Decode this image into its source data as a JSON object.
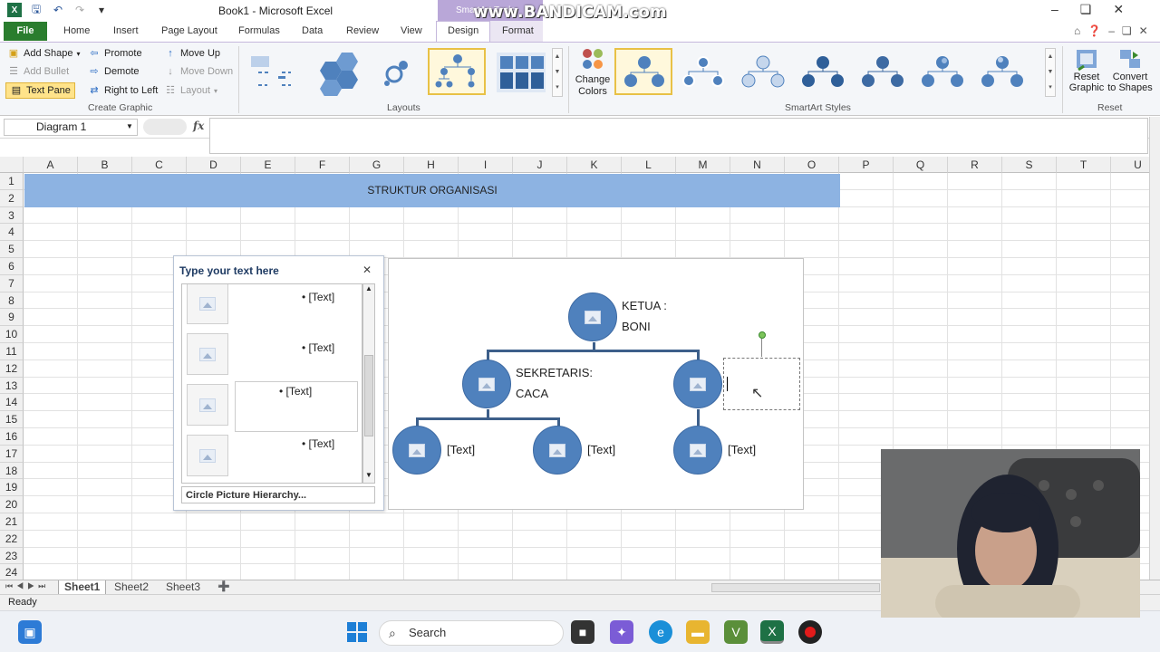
{
  "window": {
    "title": "Book1 - Microsoft Excel",
    "context_tab_title": "SmartArt Tools",
    "watermark": "www.BANDICAM.com"
  },
  "tabs": [
    "File",
    "Home",
    "Insert",
    "Page Layout",
    "Formulas",
    "Data",
    "Review",
    "View",
    "Design",
    "Format"
  ],
  "ribbon": {
    "create_graphic": {
      "label": "Create Graphic",
      "add_shape": "Add Shape",
      "add_bullet": "Add Bullet",
      "text_pane": "Text Pane",
      "promote": "Promote",
      "demote": "Demote",
      "right_to_left": "Right to Left",
      "move_up": "Move Up",
      "move_down": "Move Down",
      "layout": "Layout"
    },
    "layouts": {
      "label": "Layouts"
    },
    "change_colors": {
      "line1": "Change",
      "line2": "Colors"
    },
    "styles": {
      "label": "SmartArt Styles"
    },
    "reset": {
      "label": "Reset",
      "reset_graphic_1": "Reset",
      "reset_graphic_2": "Graphic",
      "convert_1": "Convert",
      "convert_2": "to Shapes"
    }
  },
  "formula_bar": {
    "name_box": "Diagram 1",
    "fx": "fx",
    "value": ""
  },
  "columns": [
    "A",
    "B",
    "C",
    "D",
    "E",
    "F",
    "G",
    "H",
    "I",
    "J",
    "K",
    "L",
    "M",
    "N",
    "O",
    "P",
    "Q",
    "R",
    "S",
    "T",
    "U"
  ],
  "rows": [
    "1",
    "2",
    "3",
    "4",
    "5",
    "6",
    "7",
    "8",
    "9",
    "10",
    "11",
    "12",
    "13",
    "14",
    "15",
    "16",
    "17",
    "18",
    "19",
    "20",
    "21",
    "22",
    "23",
    "24"
  ],
  "banner": {
    "text": "STRUKTUR ORGANISASI"
  },
  "text_pane": {
    "title": "Type your text here",
    "items": [
      "[Text]",
      "[Text]",
      "[Text]",
      "[Text]"
    ],
    "footer": "Circle Picture Hierarchy..."
  },
  "smartart": {
    "top": {
      "line1": "KETUA :",
      "line2": "BONI"
    },
    "left": {
      "line1": "SEKRETARIS:",
      "line2": "CACA"
    },
    "children": [
      "[Text]",
      "[Text]",
      "[Text]"
    ],
    "node_color": "#4f81bd"
  },
  "sheets": [
    "Sheet1",
    "Sheet2",
    "Sheet3"
  ],
  "status": {
    "text": "Ready"
  },
  "taskbar": {
    "search_placeholder": "Search"
  }
}
